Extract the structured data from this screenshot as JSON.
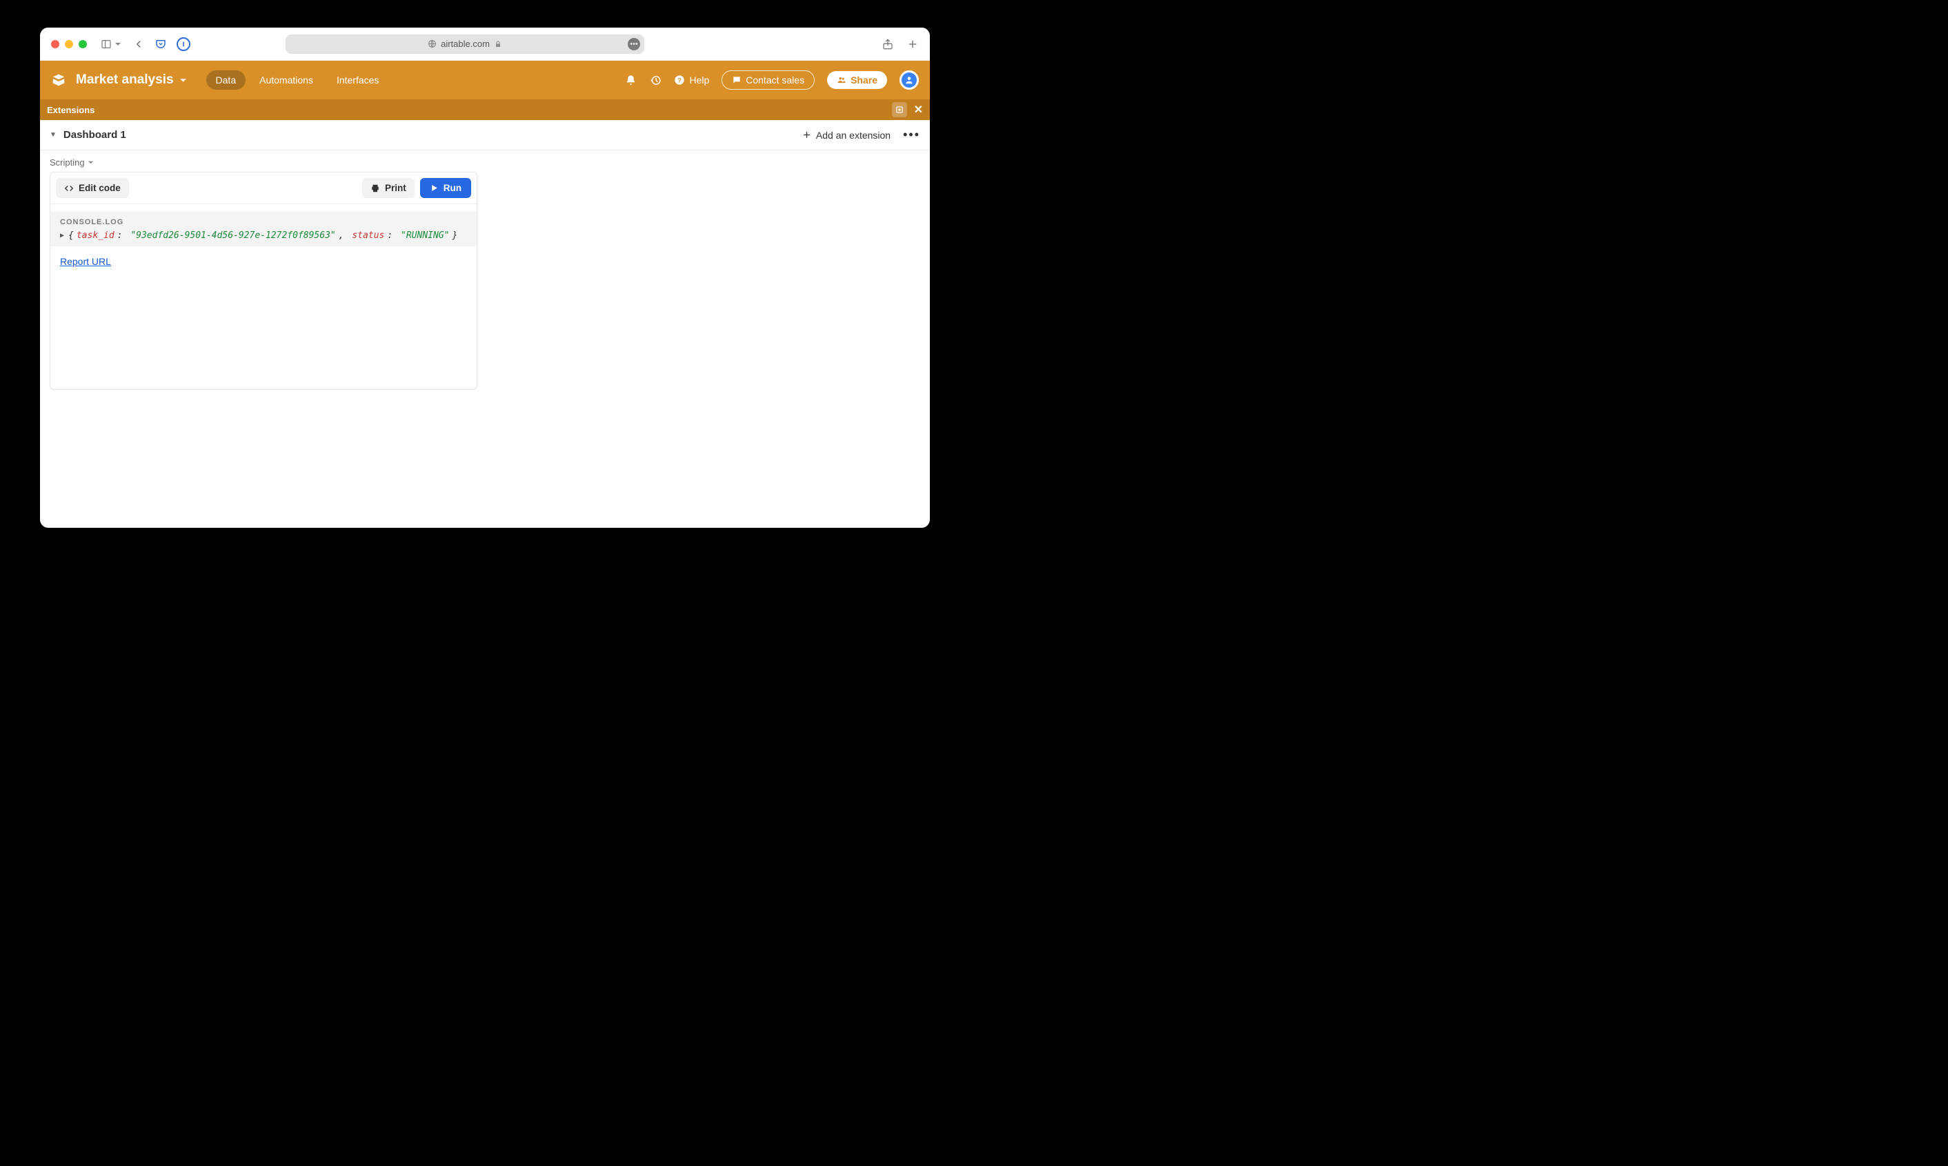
{
  "browser": {
    "url_host": "airtable.com"
  },
  "app": {
    "base_name": "Market analysis",
    "tabs": [
      "Data",
      "Automations",
      "Interfaces"
    ],
    "active_tab": 0,
    "help_label": "Help",
    "contact_label": "Contact sales",
    "share_label": "Share"
  },
  "extbar": {
    "title": "Extensions"
  },
  "dashboard": {
    "title": "Dashboard 1",
    "add_label": "Add an extension"
  },
  "scripting": {
    "label": "Scripting",
    "edit_label": "Edit code",
    "print_label": "Print",
    "run_label": "Run",
    "console_label": "CONSOLE.LOG",
    "log_object": {
      "task_id_key": "task_id",
      "task_id_val": "\"93edfd26-9501-4d56-927e-1272f0f89563\"",
      "status_key": "status",
      "status_val": "\"RUNNING\""
    },
    "report_link": "Report URL"
  }
}
